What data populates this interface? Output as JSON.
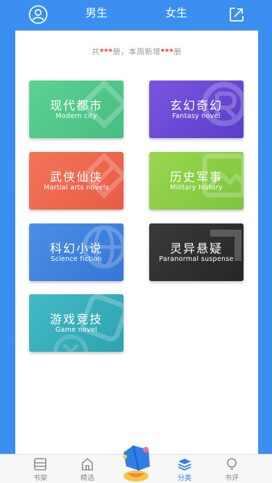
{
  "header": {
    "tab_male": "男生",
    "tab_female": "女生",
    "profile_icon": "user-circle-icon",
    "share_icon": "arrow-out-icon"
  },
  "stats": {
    "prefix": "共",
    "count1": "***",
    "middle": "册，本周新增",
    "count2": "***",
    "suffix": "册"
  },
  "categories": [
    {
      "zh": "现代都市",
      "en": "Modern city",
      "color": "#52c98a"
    },
    {
      "zh": "玄幻奇幻",
      "en": "Fantasy novel",
      "color": "#6a4bd6"
    },
    {
      "zh": "武侠仙侠",
      "en": "Martial arts novels",
      "color": "#ef6a4f"
    },
    {
      "zh": "历史军事",
      "en": "Military history",
      "color": "#8ccf45"
    },
    {
      "zh": "科幻小说",
      "en": "Science fiction",
      "color": "#3f82de"
    },
    {
      "zh": "灵异悬疑",
      "en": "Paranormal suspense",
      "color": "#333333"
    },
    {
      "zh": "游戏竞技",
      "en": "Game novel",
      "color": "#3bb0bd"
    }
  ],
  "bottom_nav": {
    "items": [
      {
        "label": "书架",
        "icon": "bookshelf-icon"
      },
      {
        "label": "精选",
        "icon": "home-icon"
      },
      {
        "label": "分类",
        "icon": "layers-icon"
      },
      {
        "label": "书评",
        "icon": "bulb-icon"
      }
    ],
    "active_color": "#2f7fe8"
  }
}
